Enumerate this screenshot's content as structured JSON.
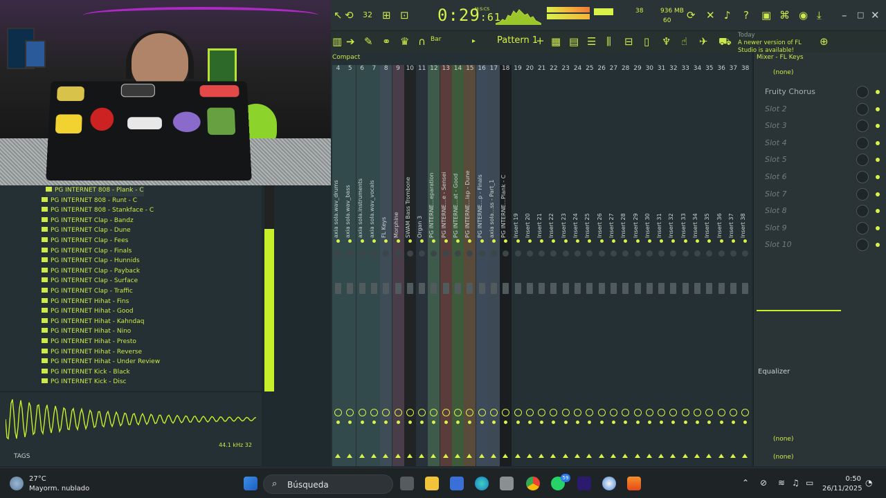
{
  "toolbar": {
    "time": "0:29",
    "time_sub": ":61",
    "time_unit_label": "M:S:CS",
    "voices": "38",
    "memory": "936 MB",
    "cpu": "60",
    "snap_label": "Bar",
    "pattern_label": "Pattern 1",
    "news_date": "Today",
    "news_text": "A newer version of FL Studio is available!",
    "tempo_display": "32"
  },
  "mixer_view": {
    "mode_label": "Compact",
    "tracks": [
      {
        "num": "4",
        "name": "axia sola.wav_drums"
      },
      {
        "num": "5",
        "name": "axia sola.wav_bass"
      },
      {
        "num": "6",
        "name": "axia sola.instruments"
      },
      {
        "num": "7",
        "name": "axia sola.wav_vocals"
      },
      {
        "num": "8",
        "name": "FL Keys"
      },
      {
        "num": "9",
        "name": "Morphine"
      },
      {
        "num": "10",
        "name": "SWAM Bass Trombone"
      },
      {
        "num": "11",
        "name": "Organ 3"
      },
      {
        "num": "12",
        "name": "PG INTERNE...eparation"
      },
      {
        "num": "13",
        "name": "PG INTERNE...e - Sensei"
      },
      {
        "num": "14",
        "name": "PG INTERNE...at - Good"
      },
      {
        "num": "15",
        "name": "PG INTERNE...lap - Dune"
      },
      {
        "num": "16",
        "name": "PG INTERNE...p - Finals"
      },
      {
        "num": "17",
        "name": "axia sola...ss - Part_1"
      },
      {
        "num": "18",
        "name": "PG INTERNE...Plank - C"
      },
      {
        "num": "19",
        "name": "Insert 19"
      },
      {
        "num": "20",
        "name": "Insert 20"
      },
      {
        "num": "21",
        "name": "Insert 21"
      },
      {
        "num": "22",
        "name": "Insert 22"
      },
      {
        "num": "23",
        "name": "Insert 23"
      },
      {
        "num": "24",
        "name": "Insert 24"
      },
      {
        "num": "25",
        "name": "Insert 25"
      },
      {
        "num": "26",
        "name": "Insert 26"
      },
      {
        "num": "27",
        "name": "Insert 27"
      },
      {
        "num": "28",
        "name": "Insert 28"
      },
      {
        "num": "29",
        "name": "Insert 29"
      },
      {
        "num": "30",
        "name": "Insert 30"
      },
      {
        "num": "31",
        "name": "Insert 31"
      },
      {
        "num": "32",
        "name": "Insert 32"
      },
      {
        "num": "33",
        "name": "Insert 33"
      },
      {
        "num": "34",
        "name": "Insert 34"
      },
      {
        "num": "35",
        "name": "Insert 35"
      },
      {
        "num": "36",
        "name": "Insert 36"
      },
      {
        "num": "37",
        "name": "Insert 37"
      },
      {
        "num": "38",
        "name": "Insert 38"
      }
    ]
  },
  "browser": {
    "items": [
      "PG INTERNET 808 - Plank - C",
      "PG INTERNET 808 - Runt - C",
      "PG INTERNET 808 - Stankface - C",
      "PG INTERNET Clap - Bandz",
      "PG INTERNET Clap - Dune",
      "PG INTERNET Clap - Fees",
      "PG INTERNET Clap - Finals",
      "PG INTERNET Clap - Hunnids",
      "PG INTERNET Clap - Payback",
      "PG INTERNET Clap - Surface",
      "PG INTERNET Clap - Traffic",
      "PG INTERNET Hihat - Fins",
      "PG INTERNET Hihat - Good",
      "PG INTERNET Hihat - Kahndaq",
      "PG INTERNET Hihat - Nino",
      "PG INTERNET Hihat - Presto",
      "PG INTERNET Hihat - Reverse",
      "PG INTERNET Hihat - Under Review",
      "PG INTERNET Kick - Black",
      "PG INTERNET Kick - Disc"
    ],
    "tags_label": "TAGS",
    "sample_info": "44.1 kHz 32"
  },
  "mixer_panel": {
    "title": "Mixer - FL Keys",
    "preset_top": "(none)",
    "slots": [
      {
        "label": "Fruity Chorus",
        "active": true
      },
      {
        "label": "Slot 2",
        "active": false
      },
      {
        "label": "Slot 3",
        "active": false
      },
      {
        "label": "Slot 4",
        "active": false
      },
      {
        "label": "Slot 5",
        "active": false
      },
      {
        "label": "Slot 6",
        "active": false
      },
      {
        "label": "Slot 7",
        "active": false
      },
      {
        "label": "Slot 8",
        "active": false
      },
      {
        "label": "Slot 9",
        "active": false
      },
      {
        "label": "Slot 10",
        "active": false
      }
    ],
    "eq_label": "Equalizer",
    "out_none": "(none)",
    "in_none": "(none)"
  },
  "taskbar": {
    "weather_temp": "27°C",
    "weather_desc": "Mayorm. nublado",
    "search_placeholder": "Búsqueda",
    "time": "0:50",
    "date": "26/11/2025",
    "whatsapp_badge": "59"
  },
  "colors": {
    "accent": "#d9f24a",
    "bg": "#243033"
  }
}
